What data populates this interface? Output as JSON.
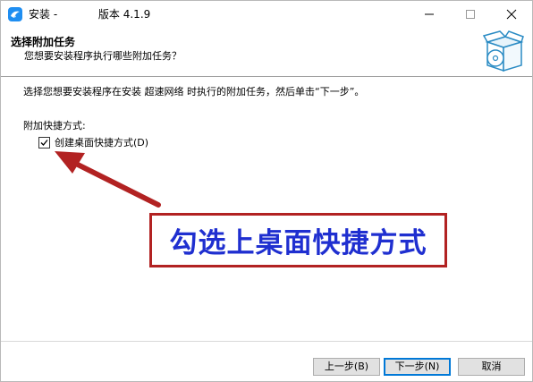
{
  "window": {
    "title": "安装 -            版本 4.1.9",
    "title_bar_controls": [
      "minimize-icon",
      "maximize-icon",
      "close-icon"
    ]
  },
  "header": {
    "title": "选择附加任务",
    "subtitle": "您想要安装程序执行哪些附加任务？"
  },
  "content": {
    "instruction": "选择您想要安装程序在安装 超速网络 时执行的附加任务，然后单击“下一步”。",
    "group_label": "附加快捷方式:",
    "checkbox_label": "创建桌面快捷方式(D)",
    "checkbox_checked": true
  },
  "annotation": {
    "text": "勾选上桌面快捷方式",
    "border_color": "#b22222",
    "text_color": "#1f2fd0",
    "arrow_color": "#b22222"
  },
  "buttons": {
    "back": "上一步(B)",
    "next": "下一步(N)",
    "cancel": "取消"
  }
}
